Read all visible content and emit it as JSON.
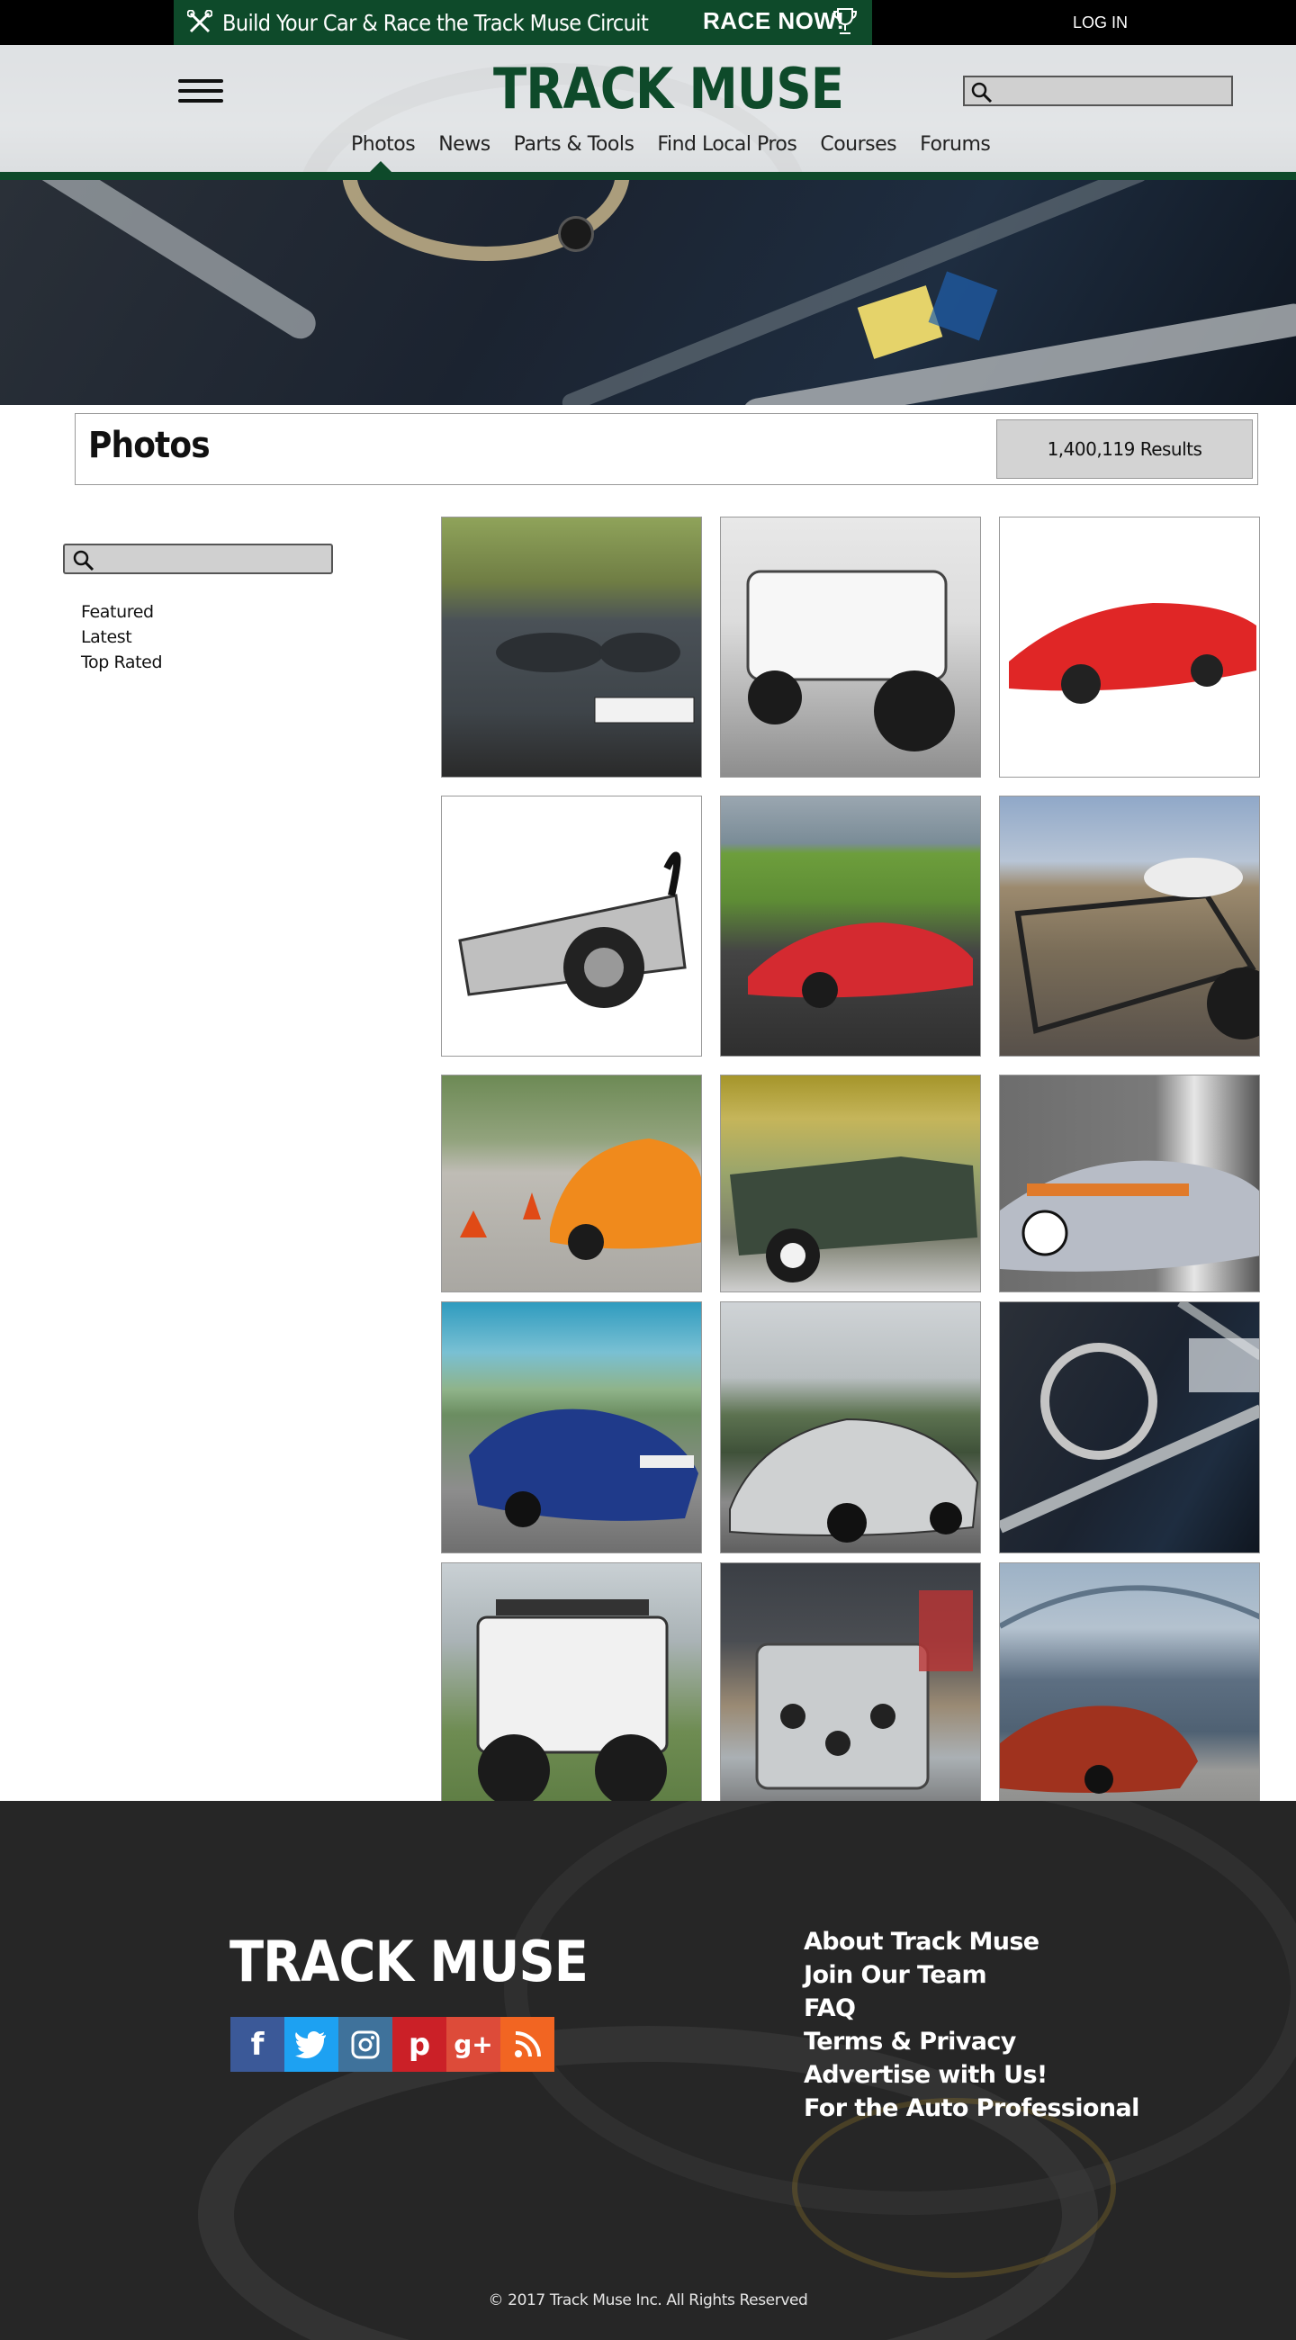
{
  "topbar": {
    "promo_text": "Build Your Car & Race the Track Muse Circuit",
    "promo_cta": "RACE NOW!",
    "login": "LOG IN"
  },
  "header": {
    "logo": "TRACK MUSE",
    "search_placeholder": "",
    "nav": [
      "Photos",
      "News",
      "Parts & Tools",
      "Find Local Pros",
      "Courses",
      "Forums"
    ],
    "active_nav": "Photos"
  },
  "page": {
    "title": "Photos",
    "results": "1,400,119 Results"
  },
  "sidebar": {
    "search_placeholder": "",
    "filters": [
      "Featured",
      "Latest",
      "Top Rated"
    ]
  },
  "footer": {
    "logo": "TRACK MUSE",
    "social": [
      {
        "icon": "facebook-icon",
        "glyph": "f",
        "color": "#3b5998"
      },
      {
        "icon": "twitter-icon",
        "glyph": "t",
        "color": "#1da1f2"
      },
      {
        "icon": "instagram-icon",
        "glyph": "◙",
        "color": "#3f729b"
      },
      {
        "icon": "pinterest-icon",
        "glyph": "p",
        "color": "#cb2027"
      },
      {
        "icon": "google-plus-icon",
        "glyph": "g+",
        "color": "#dd4b39"
      },
      {
        "icon": "rss-icon",
        "glyph": "☈",
        "color": "#f26522"
      }
    ],
    "links": [
      "About Track Muse",
      "Join Our Team",
      "FAQ",
      "Terms & Privacy",
      "Advertise with Us!",
      "For the Auto Professional"
    ],
    "copyright": "© 2017 Track Muse Inc. All Rights Reserved"
  },
  "colors": {
    "brand_green": "#0e4a2a",
    "footer_bg": "#262626"
  }
}
